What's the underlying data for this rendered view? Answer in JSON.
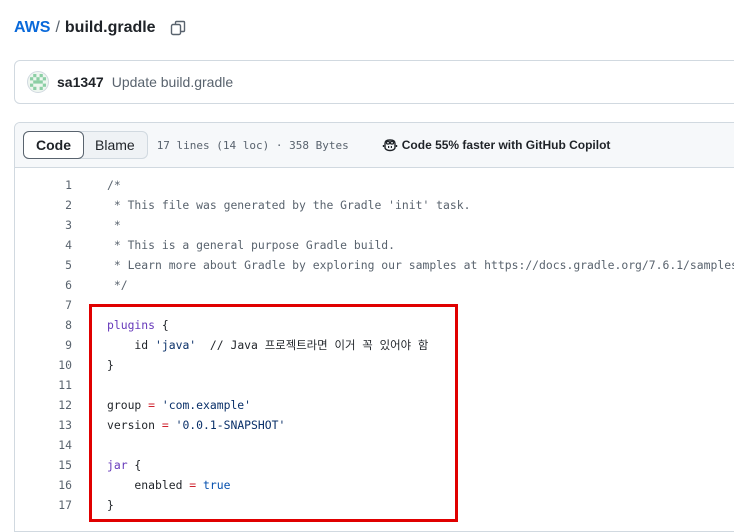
{
  "breadcrumb": {
    "repo": "AWS",
    "separator": "/",
    "file": "build.gradle"
  },
  "commit": {
    "user": "sa1347",
    "message": "Update build.gradle"
  },
  "file_header": {
    "tabs": [
      {
        "label": "Code",
        "active": true
      },
      {
        "label": "Blame",
        "active": false
      }
    ],
    "meta": "17 lines (14 loc) · 358 Bytes",
    "copilot": "Code 55% faster with GitHub Copilot"
  },
  "code_lines": [
    {
      "n": "1",
      "segs": [
        {
          "t": "/*",
          "c": "comment"
        }
      ]
    },
    {
      "n": "2",
      "segs": [
        {
          "t": " * This file was generated by the Gradle 'init' task.",
          "c": "comment"
        }
      ]
    },
    {
      "n": "3",
      "segs": [
        {
          "t": " *",
          "c": "comment"
        }
      ]
    },
    {
      "n": "4",
      "segs": [
        {
          "t": " * This is a general purpose Gradle build.",
          "c": "comment"
        }
      ]
    },
    {
      "n": "5",
      "segs": [
        {
          "t": " * Learn more about Gradle by exploring our samples at https://docs.gradle.org/7.6.1/samples",
          "c": "comment"
        }
      ]
    },
    {
      "n": "6",
      "segs": [
        {
          "t": " */",
          "c": "comment"
        }
      ]
    },
    {
      "n": "7",
      "segs": []
    },
    {
      "n": "8",
      "segs": [
        {
          "t": "plugins",
          "c": "kw"
        },
        {
          "t": " {",
          "c": ""
        }
      ]
    },
    {
      "n": "9",
      "segs": [
        {
          "t": "    id ",
          "c": ""
        },
        {
          "t": "'java'",
          "c": "str"
        },
        {
          "t": "  // Java 프로젝트라면 이거 꼭 있어야 함",
          "c": ""
        }
      ]
    },
    {
      "n": "10",
      "segs": [
        {
          "t": "}",
          "c": ""
        }
      ]
    },
    {
      "n": "11",
      "segs": []
    },
    {
      "n": "12",
      "segs": [
        {
          "t": "group ",
          "c": ""
        },
        {
          "t": "=",
          "c": "op"
        },
        {
          "t": " ",
          "c": ""
        },
        {
          "t": "'com.example'",
          "c": "str"
        }
      ]
    },
    {
      "n": "13",
      "segs": [
        {
          "t": "version ",
          "c": ""
        },
        {
          "t": "=",
          "c": "op"
        },
        {
          "t": " ",
          "c": ""
        },
        {
          "t": "'0.0.1-SNAPSHOT'",
          "c": "str"
        }
      ]
    },
    {
      "n": "14",
      "segs": []
    },
    {
      "n": "15",
      "segs": [
        {
          "t": "jar",
          "c": "kw"
        },
        {
          "t": " {",
          "c": ""
        }
      ]
    },
    {
      "n": "16",
      "segs": [
        {
          "t": "    enabled ",
          "c": ""
        },
        {
          "t": "=",
          "c": "op"
        },
        {
          "t": " ",
          "c": ""
        },
        {
          "t": "true",
          "c": "const"
        }
      ]
    },
    {
      "n": "17",
      "segs": [
        {
          "t": "}",
          "c": ""
        }
      ]
    }
  ],
  "colors": {
    "link": "#0969da",
    "highlight_border": "#e00000",
    "keyword": "#6639ba",
    "string": "#0a3069",
    "operator": "#cf222e",
    "constant": "#0550ae"
  },
  "icons": {
    "copy": "copy-icon",
    "copilot": "copilot-icon",
    "avatar": "identicon"
  }
}
